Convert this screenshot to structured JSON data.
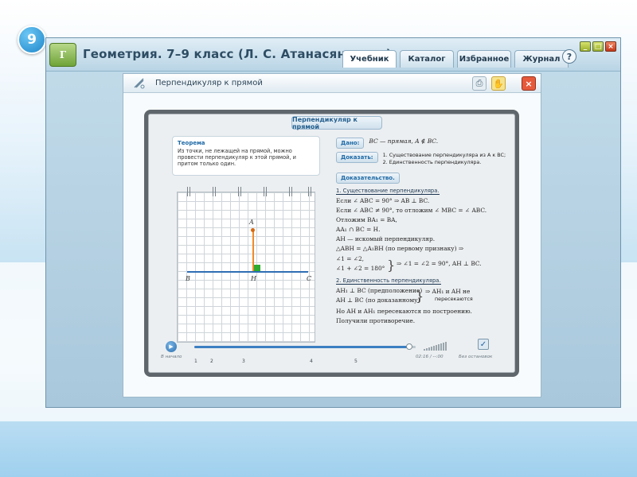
{
  "slide": {
    "number": "9"
  },
  "app": {
    "logo": "Г",
    "title": "Геометрия. 7–9 класс (Л. С. Атанасян и др.)",
    "tabs": [
      {
        "label": "Учебник",
        "active": true
      },
      {
        "label": "Каталог",
        "active": false
      },
      {
        "label": "Избранное",
        "active": false
      },
      {
        "label": "Журнал",
        "active": false
      }
    ],
    "help_label": "?",
    "window_controls": {
      "minimize": "_",
      "maximize": "□",
      "close": "×"
    }
  },
  "lesson": {
    "title": "Перпендикуляр к прямой",
    "board_title": "Перпендикуляр к прямой",
    "theorem": {
      "label": "Теорема",
      "text": "Из точки, не лежащей на прямой, можно провести перпендикуляр к этой прямой, и притом только один."
    },
    "drawing": {
      "point_a": "A",
      "point_b": "B",
      "point_h": "H",
      "point_c": "C"
    },
    "given": {
      "label": "Дано:",
      "text": "BC — прямая, A ∉ BC."
    },
    "prove": {
      "label": "Доказать:",
      "items": [
        "1. Существование перпендикуляра из A к BC;",
        "2. Единственность перпендикуляра."
      ]
    },
    "proof": {
      "label": "Доказательство.",
      "section1_title": "1. Существование перпендикуляра.",
      "section1_lines": [
        "Если ∠ ABC = 90° ⇒ AB ⊥ BC.",
        "Если ∠ ABC ≠ 90°, то отложим ∠ MBC = ∠ ABC.",
        "Отложим BA₁ = BA,",
        "AA₁ ∩ BC = H.",
        "AH — искомый перпендикуляр.",
        "△ABH = △A₁BH (по первому признаку) ⇒"
      ],
      "brace1_lines": [
        "∠1 = ∠2,",
        "∠1 + ∠2 = 180°"
      ],
      "brace1_result": "⇒ ∠1 = ∠2 = 90°, AH ⊥ BC.",
      "section2_title": "2. Единственность перпендикуляра.",
      "brace2_lines": [
        "AH₁ ⊥ BC (предположение)",
        "AH ⊥ BC (по доказанному)"
      ],
      "brace2_result_1": "⇒ AH₁ и AH не",
      "brace2_result_2": "пересекаются",
      "closing_lines": [
        "Но AH и AH₁ пересекаются по построению.",
        "Получили противоречие."
      ]
    }
  },
  "player": {
    "start_label": "В начало",
    "markers": [
      "1",
      "2",
      "3",
      "4",
      "5"
    ],
    "time": "02:16 / --:00",
    "no_stop_label": "Без остановок",
    "progress": 0.97
  }
}
